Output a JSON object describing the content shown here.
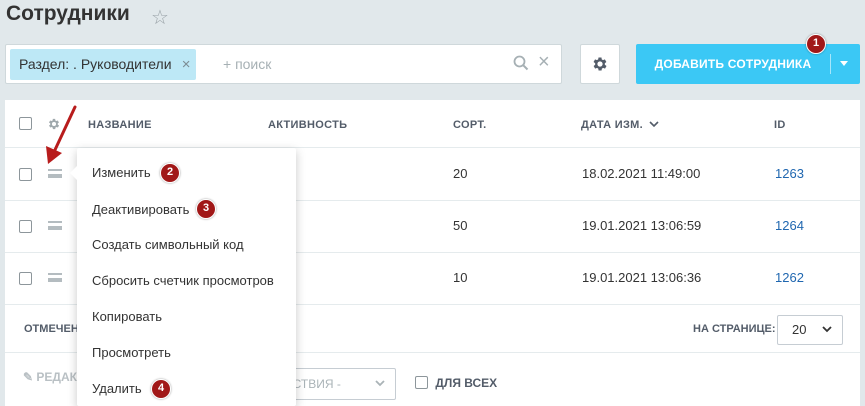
{
  "page": {
    "title": "Сотрудники"
  },
  "filter": {
    "chip_label": "Раздел: . Руководители",
    "search_placeholder": "+ поиск"
  },
  "toolbar": {
    "add_button_label": "ДОБАВИТЬ СОТРУДНИКА"
  },
  "grid": {
    "columns": [
      "НАЗВАНИЕ",
      "АКТИВНОСТЬ",
      "СОРТ.",
      "ДАТА ИЗМ.",
      "ID"
    ],
    "rows": [
      {
        "sort": "20",
        "date": "18.02.2021 11:49:00",
        "id": "1263"
      },
      {
        "sort": "50",
        "date": "19.01.2021 13:06:59",
        "id": "1264"
      },
      {
        "sort": "10",
        "date": "19.01.2021 13:06:36",
        "id": "1262"
      }
    ]
  },
  "footer": {
    "selected_label": "ОТМЕЧЕН",
    "per_page_label": "НА СТРАНИЦЕ:",
    "per_page_value": "20",
    "edit_label": "РЕДАК",
    "actions_label": "ЕЙСТВИЯ -",
    "for_all_label": "ДЛЯ ВСЕХ"
  },
  "context_menu": {
    "items": [
      "Изменить",
      "Деактивировать",
      "Создать символьный код",
      "Сбросить счетчик просмотров",
      "Копировать",
      "Просмотреть",
      "Удалить"
    ]
  },
  "annotations": [
    "1",
    "2",
    "3",
    "4"
  ],
  "colors": {
    "accent": "#3bc8f5",
    "chip": "#bde8f6",
    "badge": "#a11818",
    "link": "#2067b0",
    "background": "#e1e8eb"
  }
}
